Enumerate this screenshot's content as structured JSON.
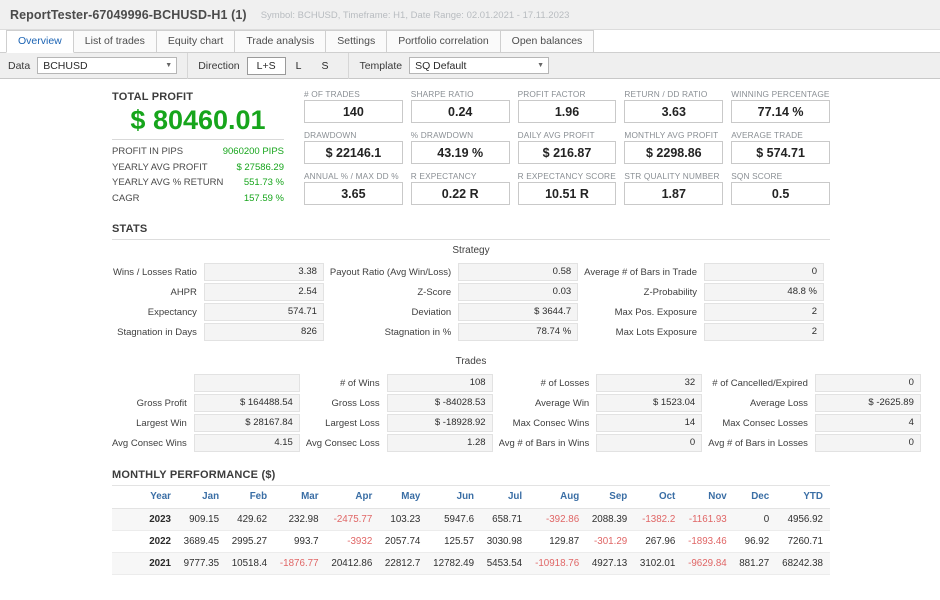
{
  "window": {
    "title": "ReportTester-67049996-BCHUSD-H1 (1)",
    "subtitle": "Symbol: BCHUSD, Timeframe: H1, Date Range: 02.01.2021 - 17.11.2023"
  },
  "tabs": [
    {
      "label": "Overview",
      "active": true
    },
    {
      "label": "List of trades",
      "active": false
    },
    {
      "label": "Equity chart",
      "active": false
    },
    {
      "label": "Trade analysis",
      "active": false
    },
    {
      "label": "Settings",
      "active": false
    },
    {
      "label": "Portfolio correlation",
      "active": false
    },
    {
      "label": "Open balances",
      "active": false
    }
  ],
  "toolbar": {
    "data_label": "Data",
    "data_value": "BCHUSD",
    "direction_label": "Direction",
    "direction_options": [
      "L+S",
      "L",
      "S"
    ],
    "direction_selected": "L+S",
    "template_label": "Template",
    "template_value": "SQ Default"
  },
  "summary": {
    "total_profit_label": "TOTAL PROFIT",
    "total_profit_value": "$ 80460.01",
    "total_profit_color": "#17a51c",
    "rows": [
      {
        "label": "PROFIT IN PIPS",
        "value": "9060200 PIPS"
      },
      {
        "label": "YEARLY AVG PROFIT",
        "value": "$ 27586.29"
      },
      {
        "label": "YEARLY AVG % RETURN",
        "value": "551.73 %"
      },
      {
        "label": "CAGR",
        "value": "157.59 %"
      }
    ]
  },
  "kpis": [
    {
      "label": "# OF TRADES",
      "value": "140"
    },
    {
      "label": "SHARPE RATIO",
      "value": "0.24"
    },
    {
      "label": "PROFIT FACTOR",
      "value": "1.96"
    },
    {
      "label": "RETURN / DD RATIO",
      "value": "3.63"
    },
    {
      "label": "WINNING PERCENTAGE",
      "value": "77.14 %"
    },
    {
      "label": "DRAWDOWN",
      "value": "$ 22146.1"
    },
    {
      "label": "% DRAWDOWN",
      "value": "43.19 %"
    },
    {
      "label": "DAILY AVG PROFIT",
      "value": "$ 216.87"
    },
    {
      "label": "MONTHLY AVG PROFIT",
      "value": "$ 2298.86"
    },
    {
      "label": "AVERAGE TRADE",
      "value": "$ 574.71"
    },
    {
      "label": "ANNUAL % / MAX DD %",
      "value": "3.65"
    },
    {
      "label": "R EXPECTANCY",
      "value": "0.22 R"
    },
    {
      "label": "R EXPECTANCY SCORE",
      "value": "10.51 R"
    },
    {
      "label": "STR QUALITY NUMBER",
      "value": "1.87"
    },
    {
      "label": "SQN SCORE",
      "value": "0.5"
    }
  ],
  "stats": {
    "section_title": "STATS",
    "strategy": {
      "title": "Strategy",
      "cells": [
        {
          "label": "Wins / Losses Ratio",
          "value": "3.38"
        },
        {
          "label": "Payout Ratio (Avg Win/Loss)",
          "value": "0.58"
        },
        {
          "label": "Average # of Bars in Trade",
          "value": "0"
        },
        {
          "label": "AHPR",
          "value": "2.54"
        },
        {
          "label": "Z-Score",
          "value": "0.03"
        },
        {
          "label": "Z-Probability",
          "value": "48.8 %"
        },
        {
          "label": "Expectancy",
          "value": "574.71"
        },
        {
          "label": "Deviation",
          "value": "$ 3644.7"
        },
        {
          "label": "Max Pos. Exposure",
          "value": "2"
        },
        {
          "label": "Stagnation in Days",
          "value": "826"
        },
        {
          "label": "Stagnation in %",
          "value": "78.74 %"
        },
        {
          "label": "Max Lots Exposure",
          "value": "2"
        }
      ]
    },
    "trades": {
      "title": "Trades",
      "cells": [
        {
          "label": "",
          "value": ""
        },
        {
          "label": "# of Wins",
          "value": "108"
        },
        {
          "label": "# of Losses",
          "value": "32"
        },
        {
          "label": "# of Cancelled/Expired",
          "value": "0"
        },
        {
          "label": "Gross Profit",
          "value": "$ 164488.54"
        },
        {
          "label": "Gross Loss",
          "value": "$ -84028.53"
        },
        {
          "label": "Average Win",
          "value": "$ 1523.04"
        },
        {
          "label": "Average Loss",
          "value": "$ -2625.89"
        },
        {
          "label": "Largest Win",
          "value": "$ 28167.84"
        },
        {
          "label": "Largest Loss",
          "value": "$ -18928.92"
        },
        {
          "label": "Max Consec Wins",
          "value": "14"
        },
        {
          "label": "Max Consec Losses",
          "value": "4"
        },
        {
          "label": "Avg Consec Wins",
          "value": "4.15"
        },
        {
          "label": "Avg Consec Loss",
          "value": "1.28"
        },
        {
          "label": "Avg # of Bars in Wins",
          "value": "0"
        },
        {
          "label": "Avg # of Bars in Losses",
          "value": "0"
        }
      ]
    }
  },
  "monthly": {
    "title": "MONTHLY PERFORMANCE ($)",
    "columns": [
      "Year",
      "Jan",
      "Feb",
      "Mar",
      "Apr",
      "May",
      "Jun",
      "Jul",
      "Aug",
      "Sep",
      "Oct",
      "Nov",
      "Dec",
      "YTD"
    ],
    "rows": [
      [
        "2023",
        "909.15",
        "429.62",
        "232.98",
        "-2475.77",
        "103.23",
        "5947.6",
        "658.71",
        "-392.86",
        "2088.39",
        "-1382.2",
        "-1161.93",
        "0",
        "4956.92"
      ],
      [
        "2022",
        "3689.45",
        "2995.27",
        "993.7",
        "-3932",
        "2057.74",
        "125.57",
        "3030.98",
        "129.87",
        "-301.29",
        "267.96",
        "-1893.46",
        "96.92",
        "7260.71"
      ],
      [
        "2021",
        "9777.35",
        "10518.4",
        "-1876.77",
        "20412.86",
        "22812.7",
        "12782.49",
        "5453.54",
        "-10918.76",
        "4927.13",
        "3102.01",
        "-9629.84",
        "881.27",
        "68242.38"
      ]
    ]
  }
}
